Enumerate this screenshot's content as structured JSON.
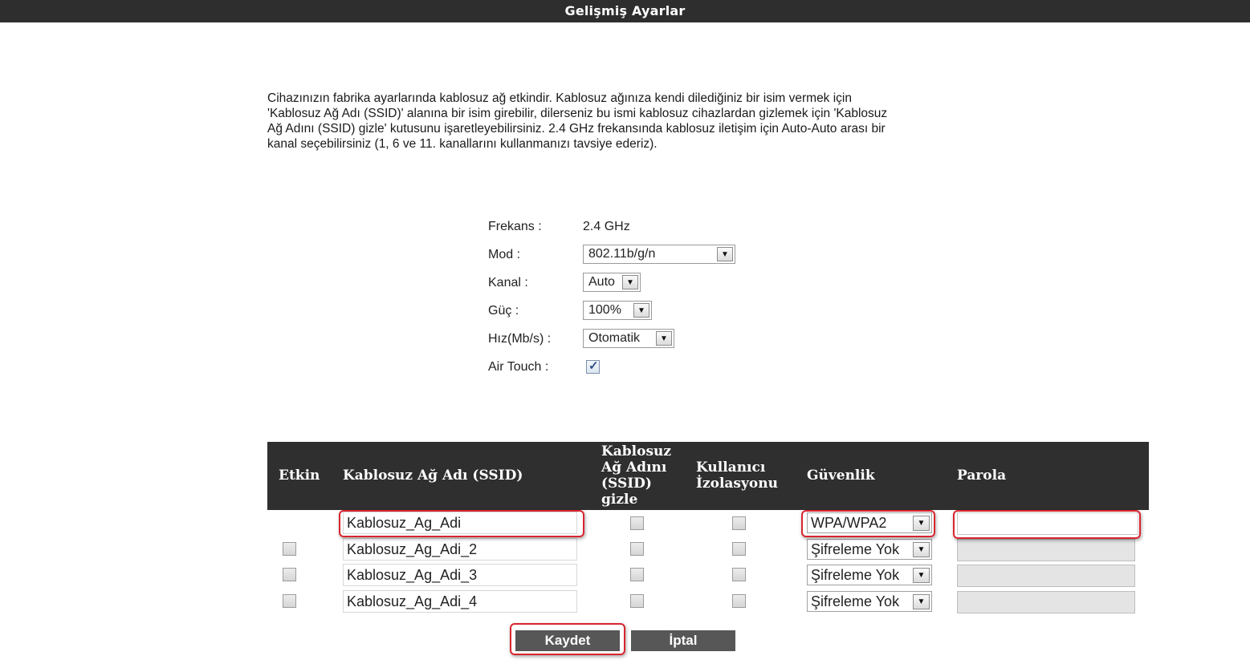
{
  "header": {
    "title": "Gelişmiş Ayarlar"
  },
  "intro": {
    "lines": [
      "Cihazınızın fabrika ayarlarında kablosuz ağ etkindir. Kablosuz ağınıza kendi dilediğiniz bir isim vermek için",
      "'Kablosuz Ağ Adı (SSID)' alanına bir isim girebilir, dilerseniz bu ismi kablosuz cihazlardan gizlemek için 'Kablosuz",
      "Ağ Adını (SSID) gizle' kutusunu işaretleyebilirsiniz. 2.4 GHz frekansında kablosuz iletişim için Auto-Auto arası bir",
      "kanal seçebilirsiniz (1, 6 ve 11. kanallarını kullanmanızı tavsiye ederiz)."
    ]
  },
  "settings": {
    "frekans": {
      "label": "Frekans :",
      "value": "2.4 GHz"
    },
    "mod": {
      "label": "Mod :",
      "value": "802.11b/g/n"
    },
    "kanal": {
      "label": "Kanal :",
      "value": "Auto"
    },
    "guc": {
      "label": "Güç :",
      "value": "100%"
    },
    "hiz": {
      "label": "Hız(Mb/s) :",
      "value": "Otomatik"
    },
    "air_touch": {
      "label": "Air Touch :",
      "checked": true
    }
  },
  "table": {
    "headers": {
      "etkin": "Etkin",
      "ssid": "Kablosuz Ağ Adı (SSID)",
      "gizle": [
        "Kablosuz",
        "Ağ Adını",
        "(SSID)",
        "gizle"
      ],
      "izolasyon": [
        "Kullanıcı",
        "İzolasyonu"
      ],
      "guvenlik": "Güvenlik",
      "parola": "Parola"
    },
    "rows": [
      {
        "ssid": "Kablosuz_Ag_Adi",
        "security": "WPA/WPA2",
        "password": ""
      },
      {
        "ssid": "Kablosuz_Ag_Adi_2",
        "security": "Şifreleme Yok",
        "password": ""
      },
      {
        "ssid": "Kablosuz_Ag_Adi_3",
        "security": "Şifreleme Yok",
        "password": ""
      },
      {
        "ssid": "Kablosuz_Ag_Adi_4",
        "security": "Şifreleme Yok",
        "password": ""
      }
    ]
  },
  "buttons": {
    "save": "Kaydet",
    "cancel": "İptal"
  },
  "icons": {
    "dropdown_arrow": "▼",
    "checkmark": "✓"
  },
  "colors": {
    "header_bg": "#2e2e2e",
    "highlight": "#d9252f",
    "button_bg": "#575757"
  }
}
